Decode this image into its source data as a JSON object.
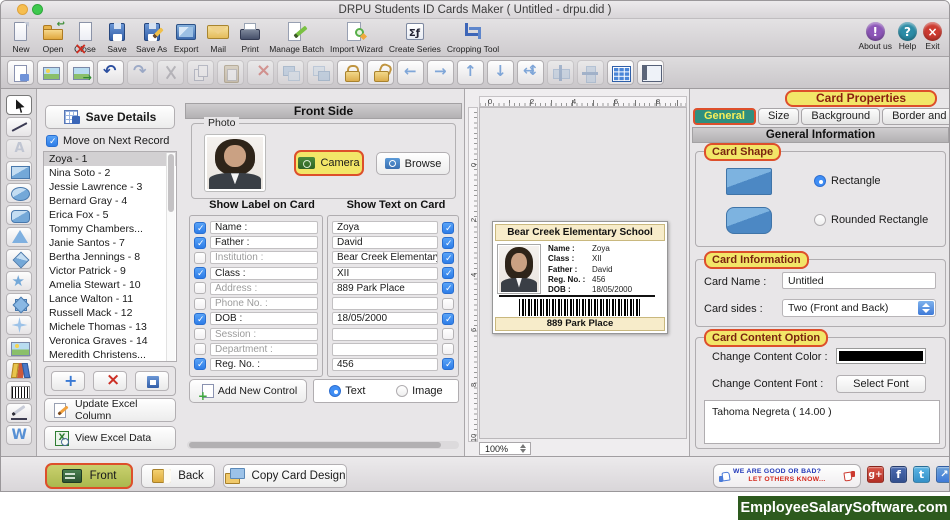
{
  "window": {
    "title": "DRPU Students ID Cards Maker ( Untitled - drpu.did )"
  },
  "colors": {
    "annotation_border": "#dd4f2b",
    "annotation_fill": "#f2e668",
    "selected_tab_green": "#2f8f7e",
    "site_bar_green": "#2d5a1e",
    "card_cream": "#f7ecca",
    "content_color_swatch": "#000000"
  },
  "toolbar": {
    "items": [
      {
        "name": "new-button",
        "icon": "new-doc",
        "label": "New"
      },
      {
        "name": "open-button",
        "icon": "open-folder",
        "label": "Open"
      },
      {
        "name": "close-button",
        "icon": "close-doc",
        "label": "Close"
      },
      {
        "name": "save-button",
        "icon": "save",
        "label": "Save"
      },
      {
        "name": "save-as-button",
        "icon": "save-as",
        "label": "Save As"
      },
      {
        "name": "export-button",
        "icon": "export",
        "label": "Export"
      },
      {
        "name": "mail-button",
        "icon": "mail",
        "label": "Mail"
      },
      {
        "name": "print-button",
        "icon": "print",
        "label": "Print"
      },
      {
        "name": "manage-batch-button",
        "icon": "manage-batch",
        "label": "Manage Batch"
      },
      {
        "name": "import-wizard-button",
        "icon": "import-wizard",
        "label": "Import Wizard"
      },
      {
        "name": "create-series-button",
        "icon": "create-series",
        "label": "Create Series"
      },
      {
        "name": "cropping-tool-button",
        "icon": "cropping-tool",
        "label": "Cropping Tool"
      }
    ],
    "right_items": [
      {
        "name": "about-us-button",
        "icon": "about-circle",
        "glyph": "!",
        "label": "About us"
      },
      {
        "name": "help-button",
        "icon": "help-circle",
        "glyph": "?",
        "label": "Help"
      },
      {
        "name": "exit-button",
        "icon": "exit-circle",
        "glyph": "×",
        "label": "Exit"
      }
    ]
  },
  "editbar": {
    "items": [
      {
        "name": "notes-button",
        "icon": "notes"
      },
      {
        "name": "image-view-button",
        "icon": "image-view"
      },
      {
        "name": "image-export-button",
        "icon": "image-export"
      },
      {
        "name": "undo-button",
        "icon": "undo"
      },
      {
        "name": "redo-button",
        "icon": "redo",
        "dim": true
      },
      {
        "name": "cut-button",
        "icon": "cut",
        "dim": true
      },
      {
        "name": "copy-button",
        "icon": "copy",
        "dim": true
      },
      {
        "name": "paste-button",
        "icon": "paste",
        "dim": true
      },
      {
        "name": "delete-button",
        "icon": "delete",
        "dim": true
      },
      {
        "name": "bring-forward-button",
        "icon": "bring-forward",
        "dim": true
      },
      {
        "name": "send-backward-button",
        "icon": "send-backward",
        "dim": true
      },
      {
        "name": "lock-button",
        "icon": "lock"
      },
      {
        "name": "unlock-button",
        "icon": "unlock"
      },
      {
        "name": "move-left-button",
        "icon": "move-left"
      },
      {
        "name": "move-right-button",
        "icon": "move-right"
      },
      {
        "name": "move-up-button",
        "icon": "move-up"
      },
      {
        "name": "move-down-button",
        "icon": "move-down"
      },
      {
        "name": "move-all-button",
        "icon": "move-all"
      },
      {
        "name": "align-horizontal-button",
        "icon": "align-horizontal",
        "dim": true
      },
      {
        "name": "align-vertical-button",
        "icon": "align-vertical",
        "dim": true
      },
      {
        "name": "grid-button",
        "icon": "grid"
      },
      {
        "name": "page-setup-button",
        "icon": "page-setup"
      }
    ]
  },
  "tools": {
    "items": [
      {
        "name": "pointer-tool",
        "icon": "pointer",
        "selected": true
      },
      {
        "name": "line-tool",
        "icon": "line"
      },
      {
        "name": "text-tool",
        "icon": "text",
        "disabled": true
      },
      {
        "name": "rectangle-tool",
        "icon": "rect"
      },
      {
        "name": "ellipse-tool",
        "icon": "ellipse"
      },
      {
        "name": "rounded-rectangle-tool",
        "icon": "rrect"
      },
      {
        "name": "triangle-tool",
        "icon": "triangle"
      },
      {
        "name": "diamond-tool",
        "icon": "diamond"
      },
      {
        "name": "star-tool",
        "icon": "star"
      },
      {
        "name": "starburst-tool",
        "icon": "burst"
      },
      {
        "name": "four-point-star-tool",
        "icon": "star4"
      },
      {
        "name": "image-tool",
        "icon": "image-tool"
      },
      {
        "name": "gallery-tool",
        "icon": "gallery"
      },
      {
        "name": "barcode-tool",
        "icon": "barcode-tool"
      },
      {
        "name": "signature-tool",
        "icon": "signature"
      },
      {
        "name": "watermark-tool",
        "icon": "watermark"
      }
    ]
  },
  "sidebar": {
    "save_details_label": "Save Details",
    "move_next_label": "Move on Next Record",
    "move_next_checked": true,
    "records": [
      {
        "label": "Zoya - 1",
        "selected": true
      },
      {
        "label": "Nina Soto - 2"
      },
      {
        "label": "Jessie Lawrence - 3"
      },
      {
        "label": "Bernard Gray - 4"
      },
      {
        "label": "Erica Fox - 5"
      },
      {
        "label": "Tommy Chambers..."
      },
      {
        "label": "Janie Santos - 7"
      },
      {
        "label": "Bertha Jennings - 8"
      },
      {
        "label": "Victor Patrick - 9"
      },
      {
        "label": "Amelia Stewart - 10"
      },
      {
        "label": "Lance Walton - 11"
      },
      {
        "label": "Russell Mack - 12"
      },
      {
        "label": "Michele Thomas - 13"
      },
      {
        "label": "Veronica Graves - 14"
      },
      {
        "label": "Meredith Christens..."
      }
    ],
    "update_excel_label": "Update Excel Column",
    "view_excel_label": "View Excel Data"
  },
  "front_side": {
    "title": "Front Side",
    "photo_label": "Photo",
    "camera_label": "Camera",
    "browse_label": "Browse",
    "label_col_header": "Show Label on Card",
    "text_col_header": "Show Text on Card",
    "rows": [
      {
        "label": "Name :",
        "value": "Zoya",
        "label_checked": true,
        "text_checked": true
      },
      {
        "label": "Father :",
        "value": "David",
        "label_checked": true,
        "text_checked": true
      },
      {
        "label": "Institution :",
        "value": "Bear Creek Elementary Sch",
        "label_checked": false,
        "text_checked": true
      },
      {
        "label": "Class :",
        "value": "XII",
        "label_checked": true,
        "text_checked": true
      },
      {
        "label": "Address :",
        "value": "889 Park Place",
        "label_checked": false,
        "text_checked": true
      },
      {
        "label": "Phone No. :",
        "value": "",
        "label_checked": false,
        "text_checked": false
      },
      {
        "label": "DOB :",
        "value": "18/05/2000",
        "label_checked": true,
        "text_checked": true
      },
      {
        "label": "Session :",
        "value": "",
        "label_checked": false,
        "text_checked": false
      },
      {
        "label": "Department :",
        "value": "",
        "label_checked": false,
        "text_checked": false
      },
      {
        "label": "Reg. No. :",
        "value": "456",
        "label_checked": true,
        "text_checked": true
      }
    ],
    "add_control_label": "Add New Control",
    "text_radio_label": "Text",
    "image_radio_label": "Image",
    "text_radio_selected": true,
    "image_radio_selected": false
  },
  "preview": {
    "ruler_h": [
      "0",
      "2",
      "4",
      "6",
      "8"
    ],
    "ruler_v": [
      "0",
      "2",
      "4",
      "6",
      "8",
      "10"
    ],
    "zoom_value": "100%"
  },
  "card": {
    "school_name": "Bear Creek Elementary School",
    "fields": [
      {
        "label": "Name :",
        "value": "Zoya"
      },
      {
        "label": "Class :",
        "value": "XII"
      },
      {
        "label": "Father :",
        "value": "David"
      },
      {
        "label": "Reg. No. :",
        "value": "456"
      },
      {
        "label": "DOB :",
        "value": "18/05/2000"
      }
    ],
    "footer": "889 Park Place"
  },
  "properties": {
    "panel_title": "Card Properties",
    "tabs": [
      {
        "label": "General",
        "selected": true
      },
      {
        "label": "Size"
      },
      {
        "label": "Background"
      },
      {
        "label": "Border and Wa..."
      }
    ],
    "section_header": "General Information",
    "card_shape": {
      "group_label": "Card Shape",
      "rectangle_label": "Rectangle",
      "rounded_label": "Rounded Rectangle",
      "rectangle_selected": true,
      "rounded_selected": false
    },
    "card_information": {
      "group_label": "Card Information",
      "card_name_label": "Card Name :",
      "card_name_value": "Untitled",
      "card_sides_label": "Card sides :",
      "card_sides_value": "Two (Front and Back)"
    },
    "card_content": {
      "group_label": "Card Content Option",
      "color_label": "Change Content Color :",
      "font_label": "Change Content Font :",
      "select_font_label": "Select Font",
      "current_font": "Tahoma Negreta ( 14.00 )"
    }
  },
  "footer": {
    "front_label": "Front",
    "back_label": "Back",
    "copy_label": "Copy Card Design",
    "feedback_line1": "WE ARE GOOD OR BAD?",
    "feedback_line2": "LET OTHERS KNOW...",
    "social": [
      {
        "name": "googleplus-icon",
        "icon": "googleplus"
      },
      {
        "name": "facebook-icon",
        "icon": "facebook"
      },
      {
        "name": "twitter-icon",
        "icon": "twitter"
      },
      {
        "name": "share-icon",
        "icon": "share"
      }
    ],
    "website": "EmployeeSalarySoftware.com"
  }
}
